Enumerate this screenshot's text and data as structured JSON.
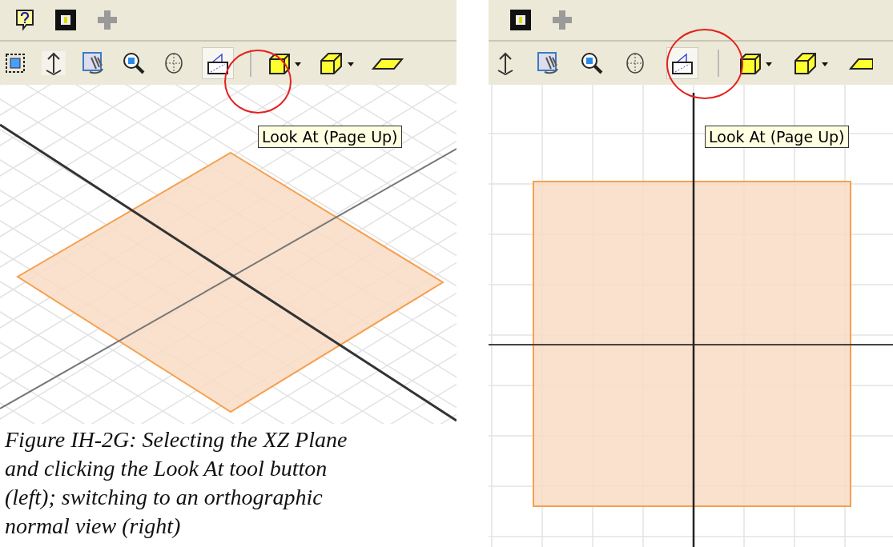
{
  "left_figure": {
    "tooltip": "Look At (Page Up)"
  },
  "right_figure": {
    "tooltip": "Look At (Page Up)"
  },
  "caption": "Figure IH-2G: Selecting the XZ Plane and clicking the Look At tool button (left); switching to an orthographic normal view (right)"
}
